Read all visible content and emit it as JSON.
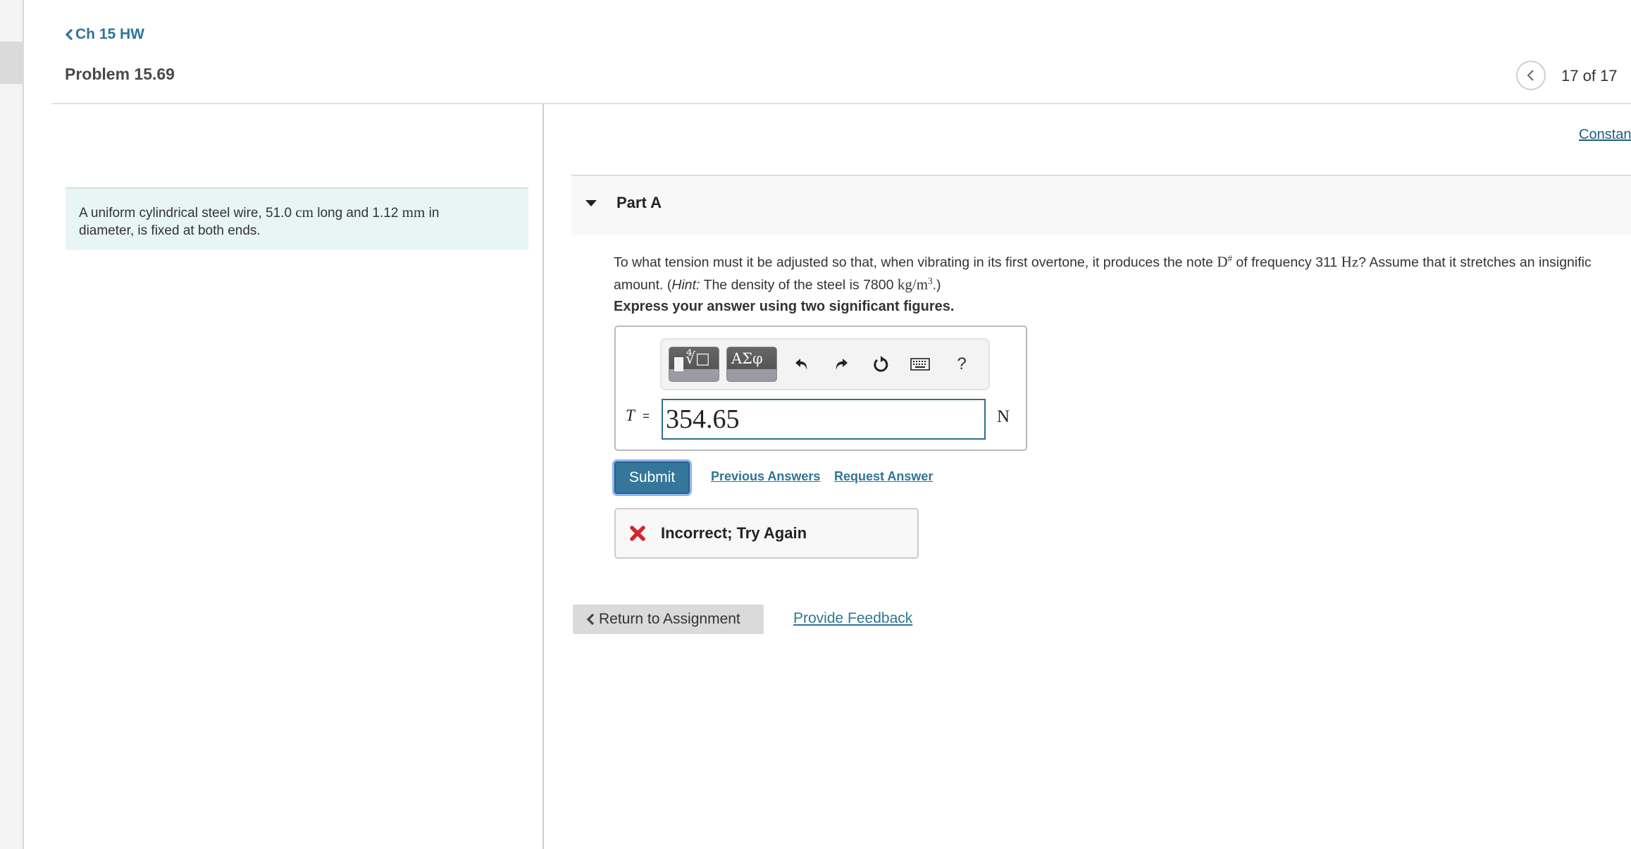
{
  "header": {
    "back_link": "Ch 15 HW",
    "problem_title": "Problem 15.69",
    "pagination": "17 of 17",
    "prev_icon": "chevron-left-icon"
  },
  "problem": {
    "text_1": "A uniform cylindrical steel wire, 51.0 ",
    "unit_cm": "cm",
    "text_2": " long and 1.12 ",
    "unit_mm": "mm",
    "text_3": " in",
    "text_4": "diameter, is fixed at both ends."
  },
  "constants_link": "Constan",
  "part": {
    "label": "Part A",
    "expanded": true,
    "question_line1_a": "To what tension must it be adjusted so that, when vibrating in its first overtone, it produces the note ",
    "note_letter": "D",
    "note_sharp": "#",
    "question_line1_b": " of frequency 311 ",
    "unit_hz": "Hz",
    "question_line1_c": "? Assume that it stretches an insignific",
    "question_line2_a": "amount. (",
    "hint_label": "Hint:",
    "question_line2_b": " The density of the steel is 7800 ",
    "density_unit": "kg/m",
    "density_exp": "3",
    "question_line2_c": ".)",
    "instruction": "Express your answer using two significant figures."
  },
  "toolbar": {
    "template_button_icon": "templates-icon",
    "greek_button_label": "ΑΣφ",
    "undo_icon": "undo-icon",
    "redo_icon": "redo-icon",
    "reset_icon": "reset-icon",
    "keyboard_icon": "keyboard-icon",
    "help_label": "?"
  },
  "answer": {
    "variable": "T",
    "equals": "=",
    "value": "354.65",
    "unit": "N"
  },
  "actions": {
    "submit_label": "Submit",
    "previous_answers_label": "Previous Answers",
    "request_answer_label": "Request Answer"
  },
  "feedback": {
    "status": "incorrect",
    "message": "Incorrect; Try Again",
    "color": "#d0282e"
  },
  "footer": {
    "return_label": "Return to Assignment",
    "provide_feedback_label": "Provide Feedback"
  },
  "colors": {
    "link": "#2e7596",
    "submit_bg": "#34779b",
    "problem_bg": "#e8f5f5"
  }
}
